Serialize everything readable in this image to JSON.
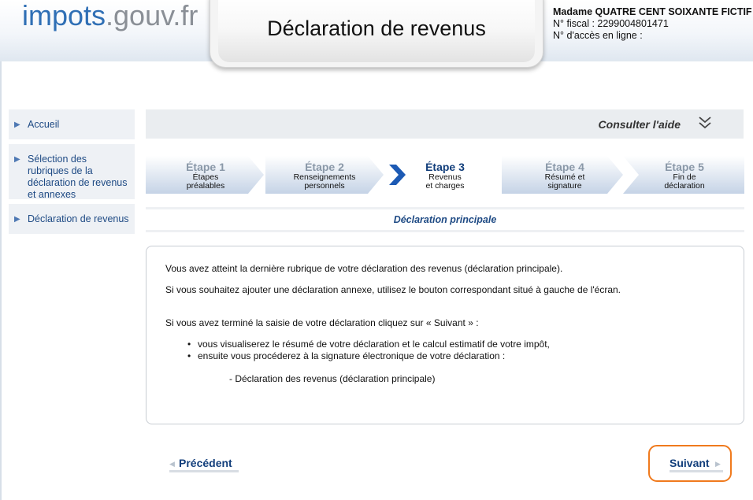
{
  "header": {
    "logo_part1": "impots",
    "logo_part2": ".gouv.fr",
    "title": "Déclaration de revenus",
    "user_name": "Madame QUATRE CENT SOIXANTE FICTIF",
    "fiscal_number": "N° fiscal : 2299004801471",
    "online_access": "N° d'accès en ligne :"
  },
  "sidebar": {
    "items": [
      {
        "label": "Accueil",
        "icon": "triangle-right-icon"
      },
      {
        "label": "Sélection des rubriques de la déclaration de revenus et annexes",
        "icon": "triangle-right-icon"
      },
      {
        "label": "Déclaration de revenus",
        "icon": "triangle-right-icon"
      }
    ]
  },
  "help": {
    "label": "Consulter l'aide",
    "icon": "double-chevron-down-icon"
  },
  "steps": {
    "active_index": 2,
    "items": [
      {
        "number": "Étape 1",
        "desc_line1": "Étapes",
        "desc_line2": "préalables"
      },
      {
        "number": "Étape 2",
        "desc_line1": "Renseignements",
        "desc_line2": "personnels"
      },
      {
        "number": "Étape 3",
        "desc_line1": "Revenus",
        "desc_line2": "et charges"
      },
      {
        "number": "Étape 4",
        "desc_line1": "Résumé et",
        "desc_line2": "signature"
      },
      {
        "number": "Étape 5",
        "desc_line1": "Fin de",
        "desc_line2": "déclaration"
      }
    ]
  },
  "section_title": "Déclaration principale",
  "content": {
    "para1": "Vous avez atteint la dernière rubrique de votre déclaration des revenus (déclaration principale).",
    "para2": "Si vous souhaitez ajouter une déclaration annexe, utilisez le bouton correspondant situé à gauche de l'écran.",
    "para3": "Si vous avez terminé la saisie de votre déclaration cliquez sur « Suivant » :",
    "bullet1": "vous visualiserez le résumé de votre déclaration et le calcul estimatif de votre impôt,",
    "bullet2": "ensuite vous procéderez à la signature électronique de votre déclaration :",
    "item": "- Déclaration des revenus (déclaration principale)"
  },
  "nav": {
    "prev_label": "Précédent",
    "next_label": "Suivant"
  },
  "colors": {
    "accent_blue": "#1e4a84",
    "logo_blue": "#2f6fb5",
    "highlight_orange": "#f07a1d"
  }
}
